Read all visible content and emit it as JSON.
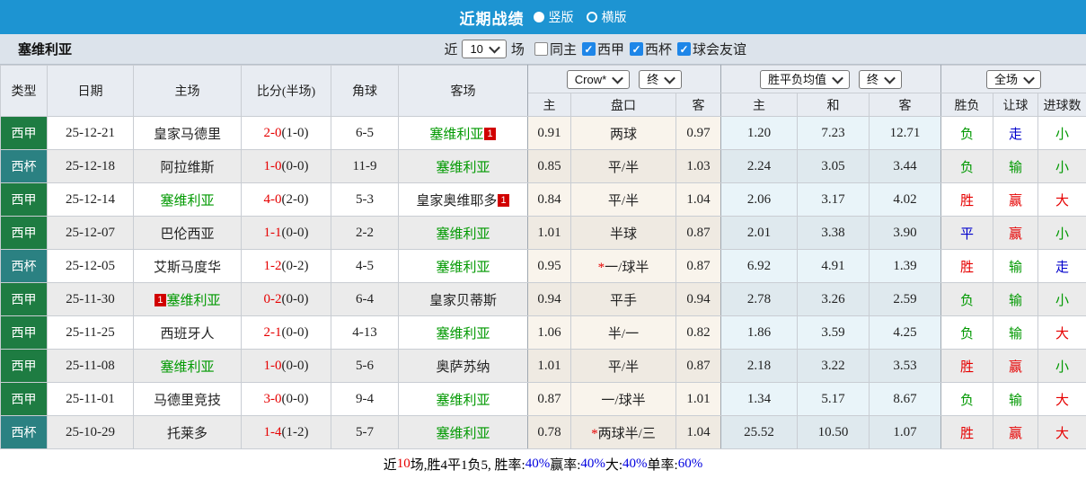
{
  "colors": {
    "topbar_bg": "#1D94D2",
    "liga_green": "#1E7C42",
    "cup_teal": "#2B8182",
    "team_green": "#009900",
    "score_red": "#E60000",
    "blue": "#0000CC",
    "link_blue": "#0101E0",
    "badge_red": "#D10000",
    "checkbox_blue": "#1E86E8"
  },
  "topbar": {
    "title": "近期战绩",
    "radios": [
      {
        "label": "竖版",
        "selected": true
      },
      {
        "label": "横版",
        "selected": false
      }
    ]
  },
  "filterbar": {
    "team": "塞维利亚",
    "near_label": "近",
    "match_count": "10",
    "matches_label": "场",
    "checkboxes": [
      {
        "label": "同主",
        "checked": false
      },
      {
        "label": "西甲",
        "checked": true
      },
      {
        "label": "西杯",
        "checked": true
      },
      {
        "label": "球会友谊",
        "checked": true
      }
    ]
  },
  "table": {
    "selects": {
      "bookmaker": "Crow*",
      "handicap_period": "终",
      "mean": "胜平负均值",
      "mean_period": "终",
      "scope": "全场"
    },
    "columns": [
      "类型",
      "日期",
      "主场",
      "比分(半场)",
      "角球",
      "客场",
      "主",
      "盘口",
      "客",
      "主",
      "和",
      "客",
      "胜负",
      "让球",
      "进球数"
    ],
    "rows": [
      {
        "type": "西甲",
        "type_key": "liga",
        "date": "25-12-21",
        "home": {
          "name": "皇家马德里",
          "green": false,
          "badge": null
        },
        "score": "2-0",
        "half": "(1-0)",
        "corners": "6-5",
        "away": {
          "name": "塞维利亚",
          "green": true,
          "badge": "1",
          "badge_pos": "after"
        },
        "odds": [
          "0.91",
          "两球",
          "0.97"
        ],
        "star": false,
        "mean": [
          "1.20",
          "7.23",
          "12.71"
        ],
        "results": [
          [
            "负",
            "green"
          ],
          [
            "走",
            "blue"
          ],
          [
            "小",
            "green"
          ]
        ]
      },
      {
        "type": "西杯",
        "type_key": "cup",
        "date": "25-12-18",
        "home": {
          "name": "阿拉维斯",
          "green": false,
          "badge": null
        },
        "score": "1-0",
        "half": "(0-0)",
        "corners": "11-9",
        "away": {
          "name": "塞维利亚",
          "green": true,
          "badge": null
        },
        "odds": [
          "0.85",
          "平/半",
          "1.03"
        ],
        "star": false,
        "mean": [
          "2.24",
          "3.05",
          "3.44"
        ],
        "results": [
          [
            "负",
            "green"
          ],
          [
            "输",
            "green"
          ],
          [
            "小",
            "green"
          ]
        ]
      },
      {
        "type": "西甲",
        "type_key": "liga",
        "date": "25-12-14",
        "home": {
          "name": "塞维利亚",
          "green": true,
          "badge": null
        },
        "score": "4-0",
        "half": "(2-0)",
        "corners": "5-3",
        "away": {
          "name": "皇家奥维耶多",
          "green": false,
          "badge": "1",
          "badge_pos": "after"
        },
        "odds": [
          "0.84",
          "平/半",
          "1.04"
        ],
        "star": false,
        "mean": [
          "2.06",
          "3.17",
          "4.02"
        ],
        "results": [
          [
            "胜",
            "red"
          ],
          [
            "赢",
            "red"
          ],
          [
            "大",
            "red"
          ]
        ]
      },
      {
        "type": "西甲",
        "type_key": "liga",
        "date": "25-12-07",
        "home": {
          "name": "巴伦西亚",
          "green": false,
          "badge": null
        },
        "score": "1-1",
        "half": "(0-0)",
        "corners": "2-2",
        "away": {
          "name": "塞维利亚",
          "green": true,
          "badge": null
        },
        "odds": [
          "1.01",
          "半球",
          "0.87"
        ],
        "star": false,
        "mean": [
          "2.01",
          "3.38",
          "3.90"
        ],
        "results": [
          [
            "平",
            "blue"
          ],
          [
            "赢",
            "red"
          ],
          [
            "小",
            "green"
          ]
        ]
      },
      {
        "type": "西杯",
        "type_key": "cup",
        "date": "25-12-05",
        "home": {
          "name": "艾斯马度华",
          "green": false,
          "badge": null
        },
        "score": "1-2",
        "half": "(0-2)",
        "corners": "4-5",
        "away": {
          "name": "塞维利亚",
          "green": true,
          "badge": null
        },
        "odds": [
          "0.95",
          "一/球半",
          "0.87"
        ],
        "star": true,
        "mean": [
          "6.92",
          "4.91",
          "1.39"
        ],
        "results": [
          [
            "胜",
            "red"
          ],
          [
            "输",
            "green"
          ],
          [
            "走",
            "blue"
          ]
        ]
      },
      {
        "type": "西甲",
        "type_key": "liga",
        "date": "25-11-30",
        "home": {
          "name": "塞维利亚",
          "green": true,
          "badge": "1",
          "badge_pos": "before"
        },
        "score": "0-2",
        "half": "(0-0)",
        "corners": "6-4",
        "away": {
          "name": "皇家贝蒂斯",
          "green": false,
          "badge": null
        },
        "odds": [
          "0.94",
          "平手",
          "0.94"
        ],
        "star": false,
        "mean": [
          "2.78",
          "3.26",
          "2.59"
        ],
        "results": [
          [
            "负",
            "green"
          ],
          [
            "输",
            "green"
          ],
          [
            "小",
            "green"
          ]
        ]
      },
      {
        "type": "西甲",
        "type_key": "liga",
        "date": "25-11-25",
        "home": {
          "name": "西班牙人",
          "green": false,
          "badge": null
        },
        "score": "2-1",
        "half": "(0-0)",
        "corners": "4-13",
        "away": {
          "name": "塞维利亚",
          "green": true,
          "badge": null
        },
        "odds": [
          "1.06",
          "半/一",
          "0.82"
        ],
        "star": false,
        "mean": [
          "1.86",
          "3.59",
          "4.25"
        ],
        "results": [
          [
            "负",
            "green"
          ],
          [
            "输",
            "green"
          ],
          [
            "大",
            "red"
          ]
        ]
      },
      {
        "type": "西甲",
        "type_key": "liga",
        "date": "25-11-08",
        "home": {
          "name": "塞维利亚",
          "green": true,
          "badge": null
        },
        "score": "1-0",
        "half": "(0-0)",
        "corners": "5-6",
        "away": {
          "name": "奥萨苏纳",
          "green": false,
          "badge": null
        },
        "odds": [
          "1.01",
          "平/半",
          "0.87"
        ],
        "star": false,
        "mean": [
          "2.18",
          "3.22",
          "3.53"
        ],
        "results": [
          [
            "胜",
            "red"
          ],
          [
            "赢",
            "red"
          ],
          [
            "小",
            "green"
          ]
        ]
      },
      {
        "type": "西甲",
        "type_key": "liga",
        "date": "25-11-01",
        "home": {
          "name": "马德里竞技",
          "green": false,
          "badge": null
        },
        "score": "3-0",
        "half": "(0-0)",
        "corners": "9-4",
        "away": {
          "name": "塞维利亚",
          "green": true,
          "badge": null
        },
        "odds": [
          "0.87",
          "一/球半",
          "1.01"
        ],
        "star": false,
        "mean": [
          "1.34",
          "5.17",
          "8.67"
        ],
        "results": [
          [
            "负",
            "green"
          ],
          [
            "输",
            "green"
          ],
          [
            "大",
            "red"
          ]
        ]
      },
      {
        "type": "西杯",
        "type_key": "cup",
        "date": "25-10-29",
        "home": {
          "name": "托莱多",
          "green": false,
          "badge": null
        },
        "score": "1-4",
        "half": "(1-2)",
        "corners": "5-7",
        "away": {
          "name": "塞维利亚",
          "green": true,
          "badge": null
        },
        "odds": [
          "0.78",
          "两球半/三",
          "1.04"
        ],
        "star": true,
        "mean": [
          "25.52",
          "10.50",
          "1.07"
        ],
        "results": [
          [
            "胜",
            "red"
          ],
          [
            "赢",
            "red"
          ],
          [
            "大",
            "red"
          ]
        ]
      }
    ]
  },
  "footer": {
    "segments": [
      [
        "近",
        "black"
      ],
      [
        "10",
        "red"
      ],
      [
        "场,胜4平1负5, 胜率:",
        "black"
      ],
      [
        "40%",
        "blue"
      ],
      [
        " 赢率:",
        "black"
      ],
      [
        "40%",
        "blue"
      ],
      [
        " 大:",
        "black"
      ],
      [
        "40%",
        "blue"
      ],
      [
        " 单率:",
        "black"
      ],
      [
        "60%",
        "blue"
      ]
    ]
  }
}
